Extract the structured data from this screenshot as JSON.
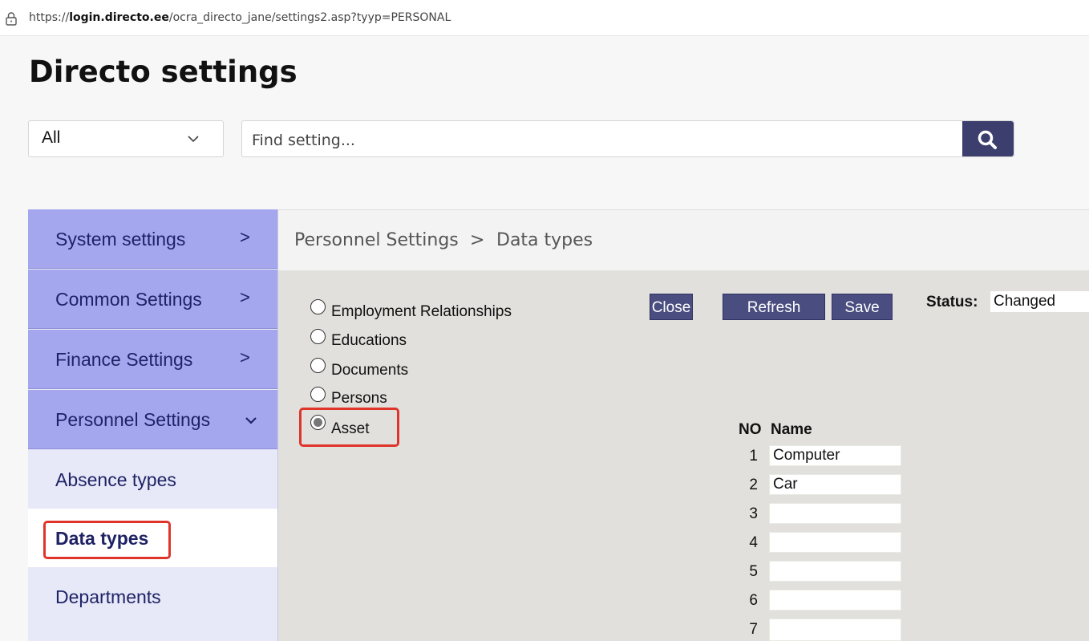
{
  "browser": {
    "url_prefix": "https://",
    "url_domain": "login.directo.ee",
    "url_path": "/ocra_directo_jane/settings2.asp?tyyp=PERSONAL"
  },
  "page": {
    "title": "Directo settings"
  },
  "filter": {
    "selected": "All"
  },
  "search": {
    "placeholder": "Find setting..."
  },
  "sidebar": {
    "items": [
      {
        "label": "System settings",
        "chevron": ">"
      },
      {
        "label": "Common Settings",
        "chevron": ">"
      },
      {
        "label": "Finance Settings",
        "chevron": ">"
      },
      {
        "label": "Personnel Settings",
        "chevron": "expanded"
      }
    ],
    "subitems": [
      {
        "label": "Absence types"
      },
      {
        "label": "Data types"
      },
      {
        "label": "Departments"
      }
    ]
  },
  "breadcrumb": {
    "parent": "Personnel Settings",
    "separator": ">",
    "current": "Data types"
  },
  "toolbar": {
    "close": "Close",
    "refresh": "Refresh",
    "save": "Save",
    "status_label": "Status:",
    "status_value": "Changed"
  },
  "radios": [
    {
      "label": "Employment Relationships",
      "checked": false
    },
    {
      "label": "Educations",
      "checked": false
    },
    {
      "label": "Documents",
      "checked": false
    },
    {
      "label": "Persons",
      "checked": false
    },
    {
      "label": "Asset",
      "checked": true
    }
  ],
  "table": {
    "headers": {
      "no": "NO",
      "name": "Name"
    },
    "rows": [
      {
        "no": "1",
        "name": "Computer"
      },
      {
        "no": "2",
        "name": "Car"
      },
      {
        "no": "3",
        "name": ""
      },
      {
        "no": "4",
        "name": ""
      },
      {
        "no": "5",
        "name": ""
      },
      {
        "no": "6",
        "name": ""
      },
      {
        "no": "7",
        "name": ""
      }
    ]
  },
  "colors": {
    "accent": "#3c3f6e",
    "nav_bg": "#a4a7ee",
    "highlight": "#e0342b"
  }
}
